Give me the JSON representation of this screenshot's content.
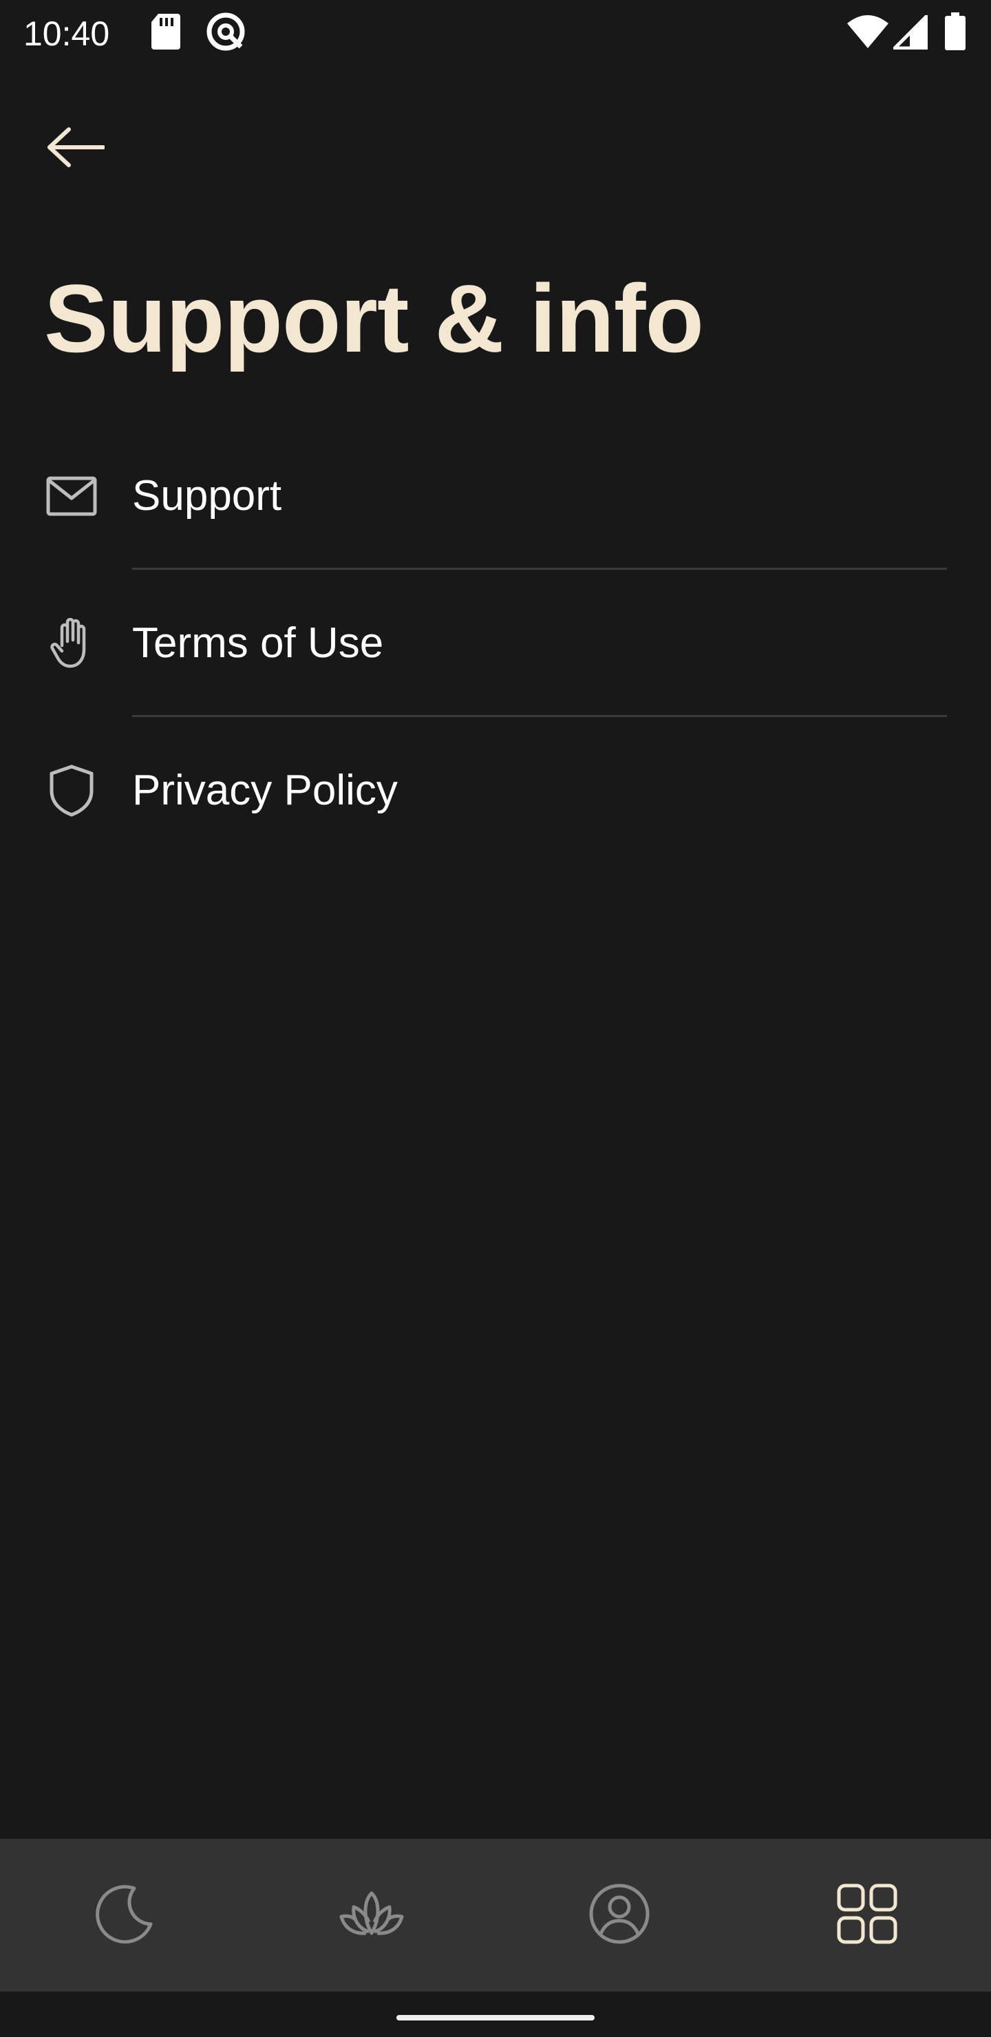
{
  "status_bar": {
    "time": "10:40",
    "icons": [
      "sd-card-icon",
      "focus-mode-icon",
      "wifi-icon",
      "cell-signal-icon",
      "battery-icon"
    ]
  },
  "header": {
    "back_icon": "arrow-left-icon",
    "title": "Support & info"
  },
  "menu": {
    "items": [
      {
        "label": "Support",
        "icon": "mail-icon"
      },
      {
        "label": "Terms of Use",
        "icon": "hand-icon"
      },
      {
        "label": "Privacy Policy",
        "icon": "shield-icon"
      }
    ]
  },
  "bottom_nav": {
    "tabs": [
      {
        "icon": "moon-icon",
        "active": false
      },
      {
        "icon": "lotus-icon",
        "active": false
      },
      {
        "icon": "profile-icon",
        "active": false
      },
      {
        "icon": "grid-icon",
        "active": true
      }
    ]
  },
  "colors": {
    "background": "#181818",
    "title": "#f4e7d1",
    "accent": "#f4e7d1",
    "nav_background": "#333333",
    "inactive_icon": "#8a8a8a",
    "divider": "#3a3a3a"
  }
}
